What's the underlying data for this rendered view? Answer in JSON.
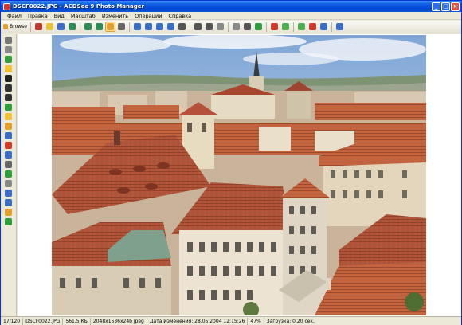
{
  "window": {
    "title": "DSCF0022.JPG - ACDSee 9 Photo Manager",
    "controls": {
      "minimize": "_",
      "maximize": "□",
      "close": "×"
    }
  },
  "menu": [
    "Файл",
    "Правка",
    "Вид",
    "Масштаб",
    "Изменить",
    "Операции",
    "Справка"
  ],
  "toolbar": {
    "browse_label": "Browse",
    "buttons": [
      {
        "name": "browse-icon",
        "color": "#E3A02C"
      },
      {
        "name": "edit-icon",
        "color": "#C0392B"
      },
      {
        "name": "open-folder-icon",
        "color": "#E8C23A"
      },
      {
        "name": "save-icon",
        "color": "#3A6EC6"
      },
      {
        "name": "prev-image-icon",
        "color": "#2E8B57"
      },
      {
        "name": "next-image-icon",
        "color": "#2E8B57"
      },
      {
        "name": "refresh-icon",
        "color": "#2E8B57"
      },
      {
        "name": "hand-tool-icon",
        "color": "#E3A02C"
      },
      {
        "name": "zoom-select-icon",
        "color": "#666666"
      },
      {
        "name": "fit-window-icon",
        "color": "#3A6EC6"
      },
      {
        "name": "fit-width-icon",
        "color": "#3A6EC6"
      },
      {
        "name": "fit-height-icon",
        "color": "#3A6EC6"
      },
      {
        "name": "actual-size-icon",
        "color": "#3A6EC6"
      },
      {
        "name": "zoom-in-icon",
        "color": "#555555"
      },
      {
        "name": "zoom-out-icon",
        "color": "#555555"
      },
      {
        "name": "zoom-dropdown-icon",
        "color": "#555555"
      },
      {
        "name": "print-icon",
        "color": "#888888"
      },
      {
        "name": "rotate-icon",
        "color": "#888888"
      },
      {
        "name": "settings-icon",
        "color": "#555555"
      },
      {
        "name": "green-square-icon",
        "color": "#2E9E3A"
      },
      {
        "name": "red-square-icon",
        "color": "#D03A2A"
      },
      {
        "name": "forward-icon",
        "color": "#4CAF50"
      },
      {
        "name": "back-green-icon",
        "color": "#4CAF50"
      },
      {
        "name": "delete-icon",
        "color": "#D03A2A"
      },
      {
        "name": "rotate-right-icon",
        "color": "#3A6EC6"
      },
      {
        "name": "help-icon",
        "color": "#3A6EC6"
      }
    ]
  },
  "sidebar": [
    {
      "name": "crop-icon",
      "color": "#777777"
    },
    {
      "name": "redeye-icon",
      "color": "#888888"
    },
    {
      "name": "green-tool-icon",
      "color": "#2E9E3A"
    },
    {
      "name": "sun-icon",
      "color": "#F2C230"
    },
    {
      "name": "contrast-icon",
      "color": "#222222"
    },
    {
      "name": "levels-icon",
      "color": "#333333"
    },
    {
      "name": "sharpen-icon",
      "color": "#333333"
    },
    {
      "name": "brush-icon",
      "color": "#2E9E3A"
    },
    {
      "name": "color-balance-icon",
      "color": "#F2C230"
    },
    {
      "name": "histogram-icon",
      "color": "#E3A02C"
    },
    {
      "name": "palette-icon",
      "color": "#3A6EC6"
    },
    {
      "name": "eye-icon",
      "color": "#D03A2A"
    },
    {
      "name": "blur-icon",
      "color": "#3A6EC6"
    },
    {
      "name": "frame-icon",
      "color": "#666666"
    },
    {
      "name": "effects-icon",
      "color": "#2E9E3A"
    },
    {
      "name": "border-icon",
      "color": "#888888"
    },
    {
      "name": "clone-icon",
      "color": "#3A6EC6"
    },
    {
      "name": "text-icon",
      "color": "#3A6EC6"
    },
    {
      "name": "draw-icon",
      "color": "#E3A02C"
    },
    {
      "name": "undo-icon",
      "color": "#2E9E3A"
    }
  ],
  "status": {
    "position": "17/120",
    "filename": "DSCF0022.JPG",
    "filesize": "561,5 КБ",
    "dimensions": "2048x1536x24b jpeg",
    "date": "Дата Изменения: 28.05.2004 12:15:26",
    "zoom": "47%",
    "load_time": "Загрузка: 0.20 сек."
  }
}
